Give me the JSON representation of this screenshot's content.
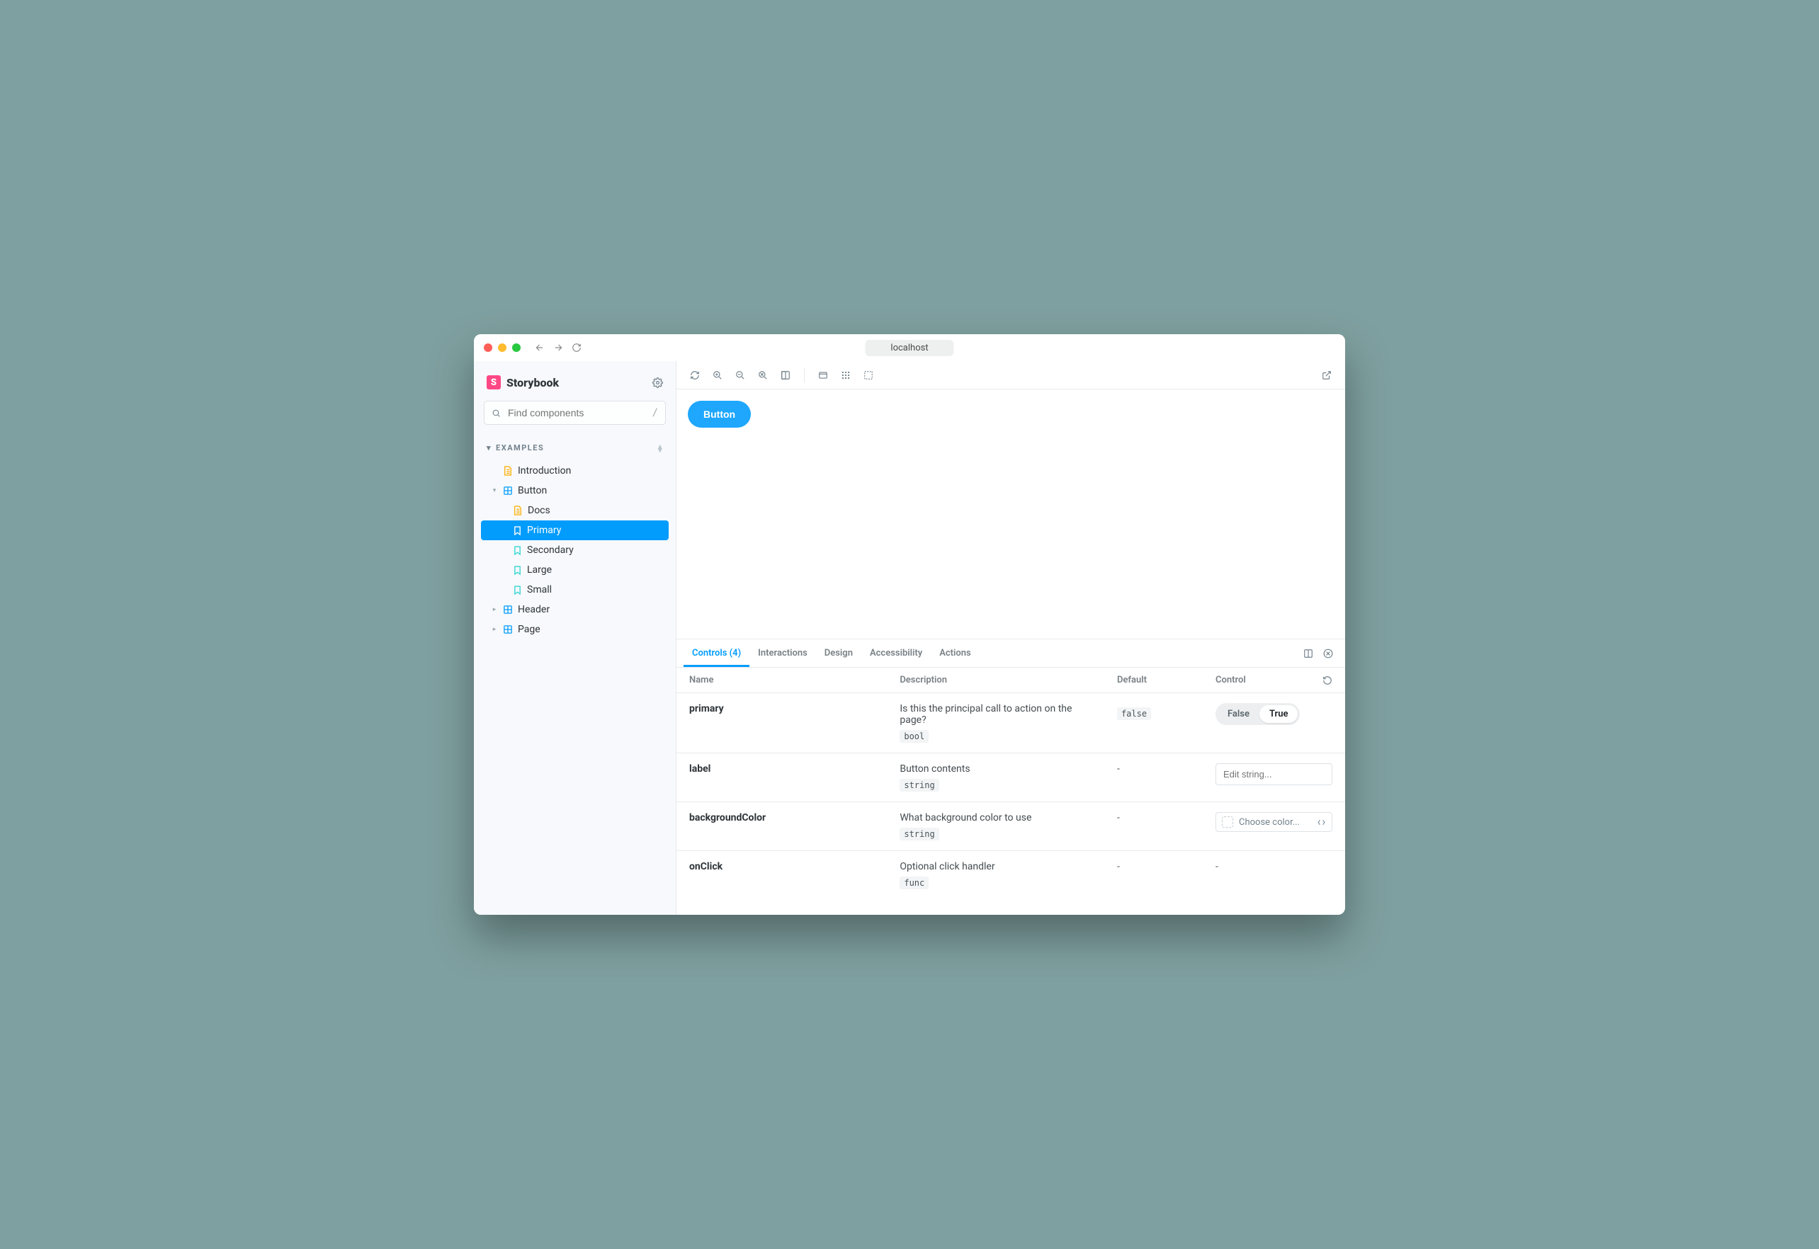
{
  "chrome": {
    "address": "localhost"
  },
  "brand": {
    "logo_letter": "S",
    "name": "Storybook"
  },
  "search": {
    "placeholder": "Find components",
    "shortcut": "/"
  },
  "sections": {
    "examples_label": "EXAMPLES"
  },
  "tree": {
    "introduction": "Introduction",
    "button": "Button",
    "docs": "Docs",
    "primary": "Primary",
    "secondary": "Secondary",
    "large": "Large",
    "small": "Small",
    "header": "Header",
    "page": "Page"
  },
  "preview": {
    "button_label": "Button"
  },
  "tabs": {
    "controls": "Controls (4)",
    "interactions": "Interactions",
    "design": "Design",
    "accessibility": "Accessibility",
    "actions": "Actions"
  },
  "table": {
    "headers": {
      "name": "Name",
      "description": "Description",
      "default": "Default",
      "control": "Control"
    },
    "rows": {
      "primary": {
        "name": "primary",
        "desc": "Is this the principal call to action on the page?",
        "type": "bool",
        "default": "false",
        "false_label": "False",
        "true_label": "True"
      },
      "label": {
        "name": "label",
        "desc": "Button contents",
        "type": "string",
        "default": "-",
        "placeholder": "Edit string..."
      },
      "backgroundColor": {
        "name": "backgroundColor",
        "desc": "What background color to use",
        "type": "string",
        "default": "-",
        "placeholder": "Choose color..."
      },
      "onClick": {
        "name": "onClick",
        "desc": "Optional click handler",
        "type": "func",
        "default": "-",
        "control": "-"
      }
    }
  }
}
